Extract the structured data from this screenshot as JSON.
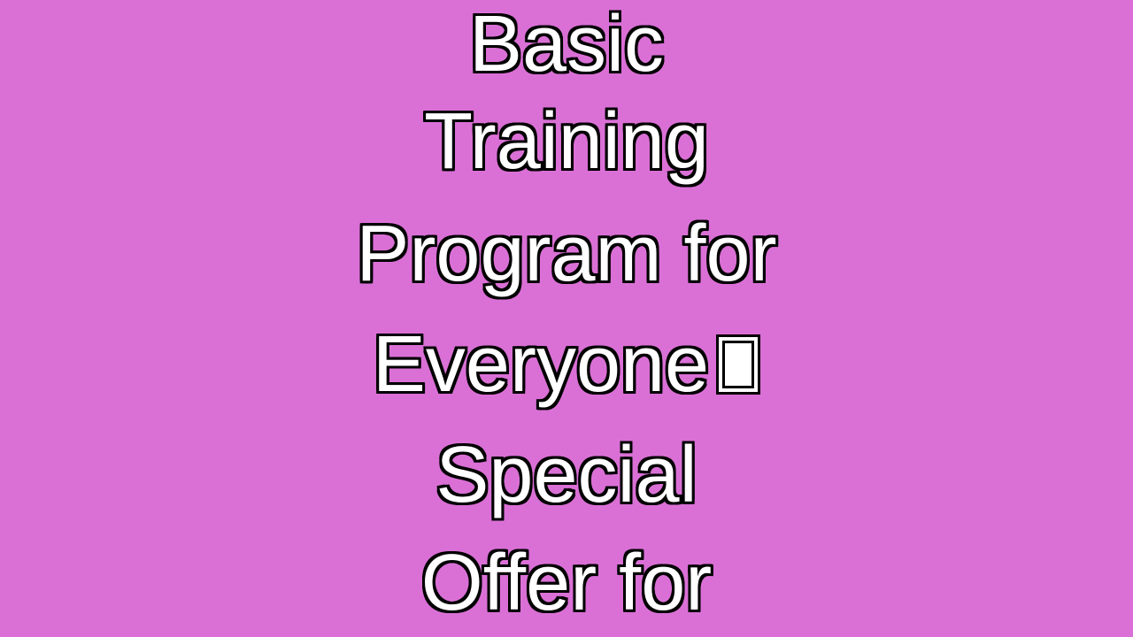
{
  "background_color": "#DA70D6",
  "text_fill_color": "#FFFFFF",
  "text_outline_color": "#000000",
  "caption": {
    "lines": [
      "Basic",
      "Training",
      "Program for",
      "Everyone",
      "Special",
      "Offer for"
    ],
    "unrendered_glyph_icon": "missing-glyph-box"
  }
}
